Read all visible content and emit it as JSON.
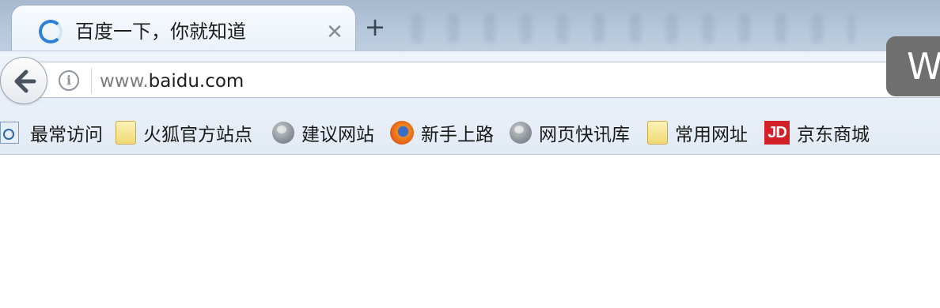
{
  "tab": {
    "title": "百度一下，你就知道",
    "close_glyph": "✕",
    "new_tab_glyph": "+"
  },
  "address_bar": {
    "url_prefix": "www.",
    "url_domain": "baidu.com",
    "info_glyph": "i"
  },
  "popup": {
    "text": "W"
  },
  "bookmarks": [
    {
      "label": "最常访问",
      "icon": "search-page-icon"
    },
    {
      "label": "火狐官方站点",
      "icon": "folder-icon"
    },
    {
      "label": "建议网站",
      "icon": "globe-icon"
    },
    {
      "label": "新手上路",
      "icon": "firefox-icon"
    },
    {
      "label": "网页快讯库",
      "icon": "globe-icon"
    },
    {
      "label": "常用网址",
      "icon": "folder-icon"
    },
    {
      "label": "京东商城",
      "icon": "jd-icon",
      "icon_text": "JD"
    }
  ],
  "colors": {
    "accent": "#2b7fd6",
    "jd_red": "#d31f26"
  }
}
